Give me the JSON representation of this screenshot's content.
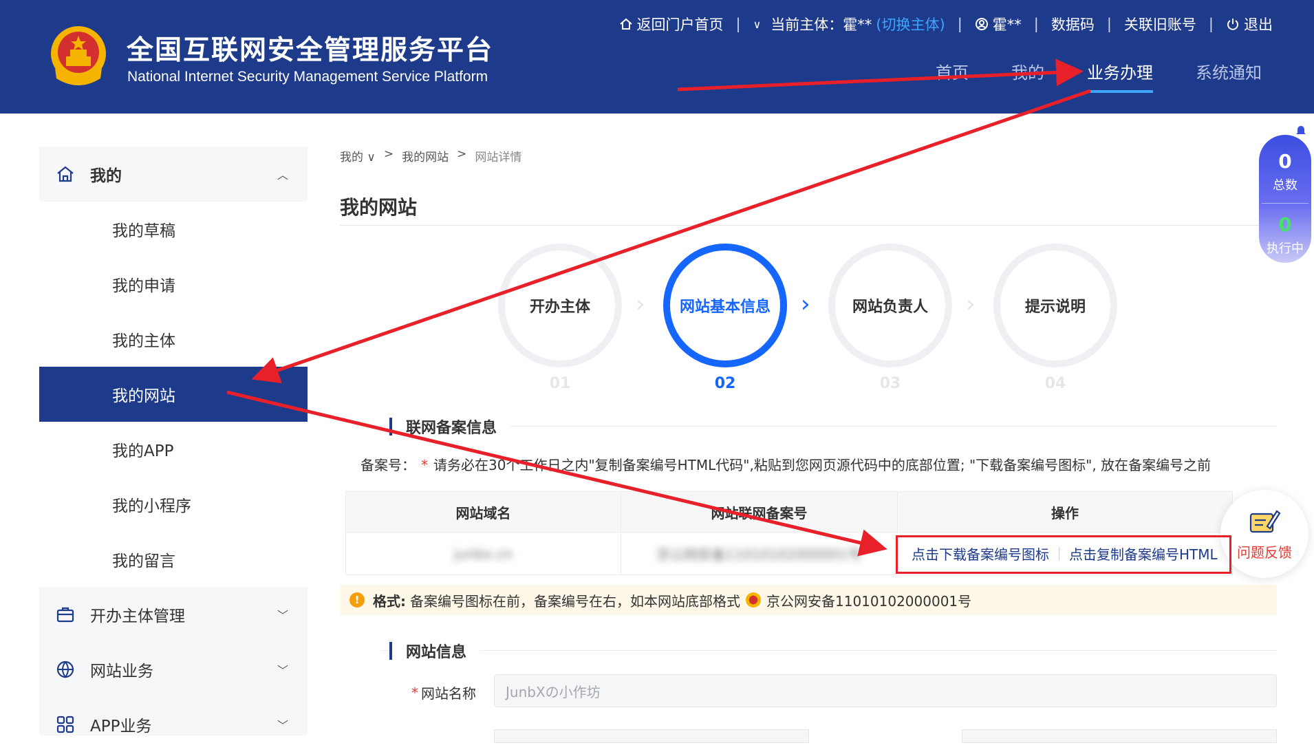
{
  "header": {
    "title_cn": "全国互联网安全管理服务平台",
    "title_en": "National Internet Security Management Service Platform",
    "topbar": {
      "home": "返回门户首页",
      "subject_label": "当前主体：霍**",
      "switch": "(切换主体)",
      "user": "霍**",
      "datacode": "数据码",
      "link_old": "关联旧账号",
      "logout": "退出"
    },
    "nav": [
      "首页",
      "我的",
      "业务办理",
      "系统通知"
    ],
    "nav_active": "业务办理"
  },
  "sidebar": {
    "group_mine": "我的",
    "items": [
      "我的草稿",
      "我的申请",
      "我的主体",
      "我的网站",
      "我的APP",
      "我的小程序",
      "我的留言"
    ],
    "active_item": "我的网站",
    "group_entity": "开办主体管理",
    "group_website": "网站业务",
    "group_app": "APP业务"
  },
  "breadcrumb": [
    "我的",
    "我的网站",
    "网站详情"
  ],
  "page_title": "我的网站",
  "steps": [
    {
      "label": "开办主体",
      "num": "01"
    },
    {
      "label": "网站基本信息",
      "num": "02"
    },
    {
      "label": "网站负责人",
      "num": "03"
    },
    {
      "label": "提示说明",
      "num": "04"
    }
  ],
  "active_step": 2,
  "filing": {
    "heading": "联网备案信息",
    "note_label": "备案号：",
    "note_star": "*",
    "note_text": "请务必在30个工作日之内\"复制备案编号HTML代码\",粘贴到您网页源代码中的底部位置; \"下载备案编号图标\", 放在备案编号之前",
    "table_headers": [
      "网站域名",
      "网站联网备案号",
      "操作"
    ],
    "domain_value": "junbx.cn",
    "record_value": "京公网安备11010102000001号",
    "op_download": "点击下载备案编号图标",
    "op_copy": "点击复制备案编号HTML"
  },
  "format": {
    "label": "格式:",
    "text": "备案编号图标在前，备案编号在右，如本网站底部格式",
    "example": "京公网安备11010102000001号"
  },
  "site_info": {
    "heading": "网站信息",
    "name_label": "网站名称",
    "name_value": "JunbXの小作坊"
  },
  "counter": {
    "total_num": "0",
    "total_label": "总数",
    "running_num": "0",
    "running_label": "执行中"
  },
  "feedback_label": "问题反馈",
  "colors": {
    "brand": "#1e3a8a",
    "accent": "#1565ff",
    "annotation": "#e8202a"
  }
}
